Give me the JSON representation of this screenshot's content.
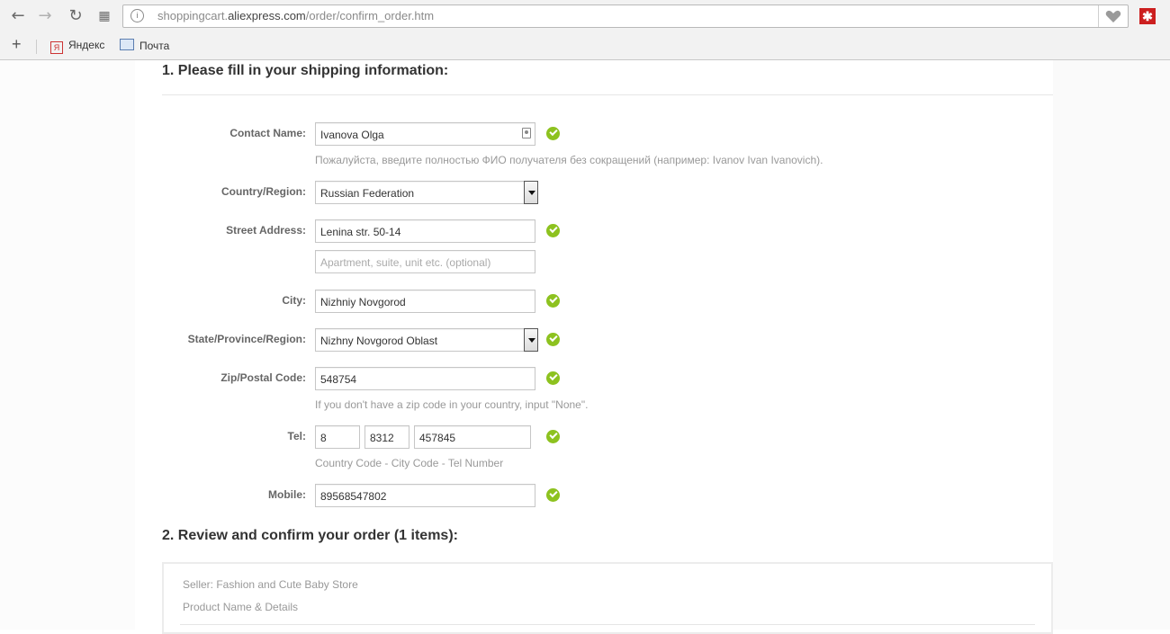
{
  "browser": {
    "url_prefix": "shoppingcart.",
    "url_domain": "aliexpress.com",
    "url_path": "/order/confirm_order.htm",
    "bookmarks": [
      {
        "label": "Яндекс",
        "icon": "yandex-icon"
      },
      {
        "label": "Почта",
        "icon": "mail-icon"
      }
    ]
  },
  "shipping": {
    "title": "1. Please fill in your shipping information:",
    "contact_name": {
      "label": "Contact Name:",
      "value": "Ivanova Olga",
      "hint": "Пожалуйста, введите полностью ФИО получателя без сокращений (например: Ivanov Ivan Ivanovich)."
    },
    "country": {
      "label": "Country/Region:",
      "value": "Russian Federation"
    },
    "street": {
      "label": "Street Address:",
      "value": "Lenina str. 50-14",
      "placeholder2": "Apartment, suite, unit etc. (optional)"
    },
    "city": {
      "label": "City:",
      "value": "Nizhniy Novgorod"
    },
    "state": {
      "label": "State/Province/Region:",
      "value": "Nizhny Novgorod Oblast"
    },
    "zip": {
      "label": "Zip/Postal Code:",
      "value": "548754",
      "hint": "If you don't have a zip code in your country, input \"None\"."
    },
    "tel": {
      "label": "Tel:",
      "country_code": "8",
      "city_code": "8312",
      "number": "457845",
      "hint": "Country Code - City Code - Tel Number"
    },
    "mobile": {
      "label": "Mobile:",
      "value": "89568547802"
    }
  },
  "review": {
    "title": "2. Review and confirm your order (1 items):",
    "seller": "Seller: Fashion and Cute Baby Store",
    "product_header": "Product Name & Details"
  },
  "colors": {
    "check": "#8dc21f",
    "ext_icon": "#cc1f1f"
  }
}
